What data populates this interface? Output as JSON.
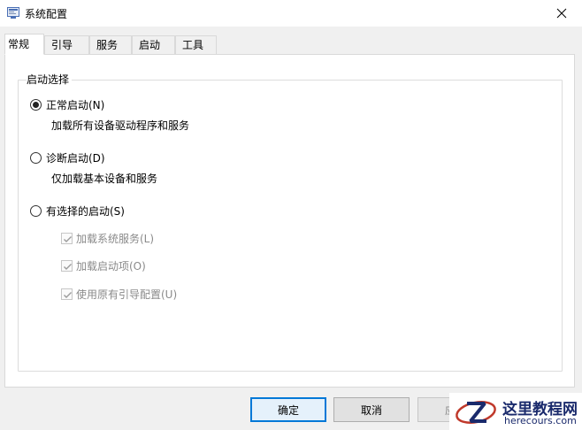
{
  "window": {
    "title": "系统配置"
  },
  "tabs": [
    {
      "label": "常规",
      "active": true
    },
    {
      "label": "引导",
      "active": false
    },
    {
      "label": "服务",
      "active": false
    },
    {
      "label": "启动",
      "active": false
    },
    {
      "label": "工具",
      "active": false
    }
  ],
  "startup_selection": {
    "legend": "启动选择",
    "options": [
      {
        "label": "正常启动(N)",
        "description": "加载所有设备驱动程序和服务",
        "checked": true
      },
      {
        "label": "诊断启动(D)",
        "description": "仅加载基本设备和服务",
        "checked": false
      },
      {
        "label": "有选择的启动(S)",
        "checked": false
      }
    ],
    "selective_items": [
      {
        "label": "加载系统服务(L)",
        "checked": true,
        "enabled": false
      },
      {
        "label": "加载启动项(O)",
        "checked": true,
        "enabled": false
      },
      {
        "label": "使用原有引导配置(U)",
        "checked": true,
        "enabled": false
      }
    ]
  },
  "buttons": {
    "ok": "确定",
    "cancel": "取消",
    "apply": "应用"
  },
  "watermark": {
    "title": "这里教程网",
    "url": "herecours.com"
  },
  "colors": {
    "accent": "#0078d7",
    "watermark": "#1a2a6c"
  }
}
